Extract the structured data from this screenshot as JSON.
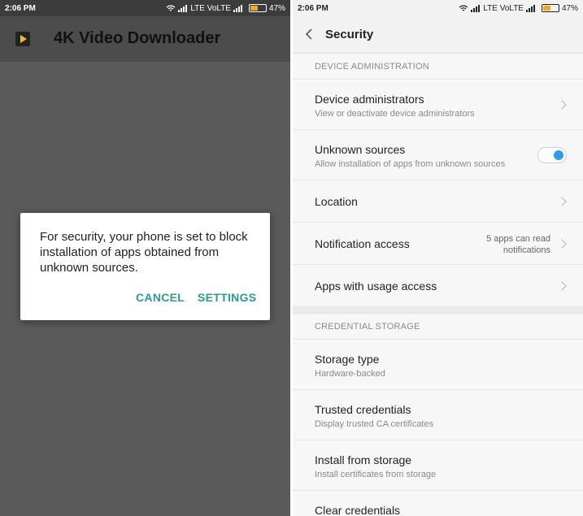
{
  "left": {
    "status_time": "2:06 PM",
    "status_network": "LTE VoLTE",
    "status_battery": "47%",
    "app_title": "4K Video Downloader",
    "dialog": {
      "message": "For security, your phone is set to block installation of apps obtained from unknown sources.",
      "cancel_label": "CANCEL",
      "settings_label": "SETTINGS"
    }
  },
  "right": {
    "status_time": "2:06 PM",
    "status_network": "LTE VoLTE",
    "status_battery": "47%",
    "header_title": "Security",
    "sections": [
      {
        "heading": "DEVICE ADMINISTRATION",
        "items": [
          {
            "title": "Device administrators",
            "subtitle": "View or deactivate device administrators"
          },
          {
            "title": "Unknown sources",
            "subtitle": "Allow installation of apps from unknown sources",
            "toggle_on": true
          },
          {
            "title": "Location"
          },
          {
            "title": "Notification access",
            "aside_line1": "5 apps can read",
            "aside_line2": "notifications"
          },
          {
            "title": "Apps with usage access"
          }
        ]
      },
      {
        "heading": "CREDENTIAL STORAGE",
        "items": [
          {
            "title": "Storage type",
            "subtitle": "Hardware-backed"
          },
          {
            "title": "Trusted credentials",
            "subtitle": "Display trusted CA certificates"
          },
          {
            "title": "Install from storage",
            "subtitle": "Install certificates from storage"
          },
          {
            "title": "Clear credentials"
          }
        ]
      }
    ]
  },
  "colors": {
    "accent_teal": "#2a9d8f",
    "toggle_blue": "#2d9cf0",
    "battery_orange": "#f5a623"
  },
  "icons": [
    "wifi-icon",
    "signal-icon",
    "battery-icon",
    "app-play-icon",
    "back-arrow-icon",
    "chevron-right-icon"
  ]
}
